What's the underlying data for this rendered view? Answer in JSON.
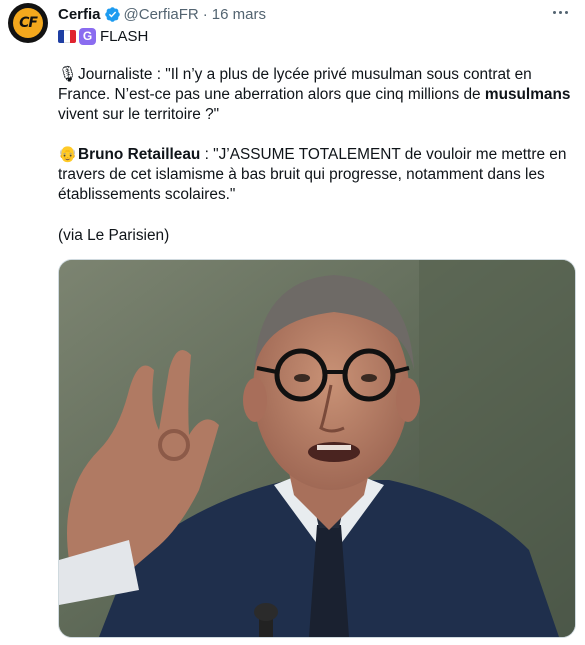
{
  "author": {
    "name": "Cerfia",
    "handle": "@CerfiaFR",
    "date": "16 mars",
    "avatar_text": "CF"
  },
  "flash_label": "FLASH",
  "flash_badge": "G",
  "paragraphs": {
    "journalist": {
      "emoji": "🎙",
      "lead": "Journaliste : \"Il n’y a plus de lycée privé musulman sous contrat en France. N’est-ce pas une aberration alors que cinq millions de ",
      "bold": "musulmans",
      "tail": " vivent sur le territoire ?\""
    },
    "retailleau": {
      "emoji": "👴",
      "speaker": "Bruno Retailleau",
      "quote": " : \"J’ASSUME TOTALEMENT de vouloir me mettre en travers de cet islamisme à bas bruit qui progresse, notamment dans les établissements scolaires.\""
    },
    "source": "(via Le Parisien)"
  },
  "icons": {
    "verified": "verified-badge-icon",
    "more": "more-options-icon",
    "flag": "france-flag-icon"
  },
  "colors": {
    "verified_blue": "#1d9bf0",
    "secondary_text": "#536471",
    "avatar_accent": "#f4a81d",
    "badge_purple": "#8a6cf0"
  }
}
